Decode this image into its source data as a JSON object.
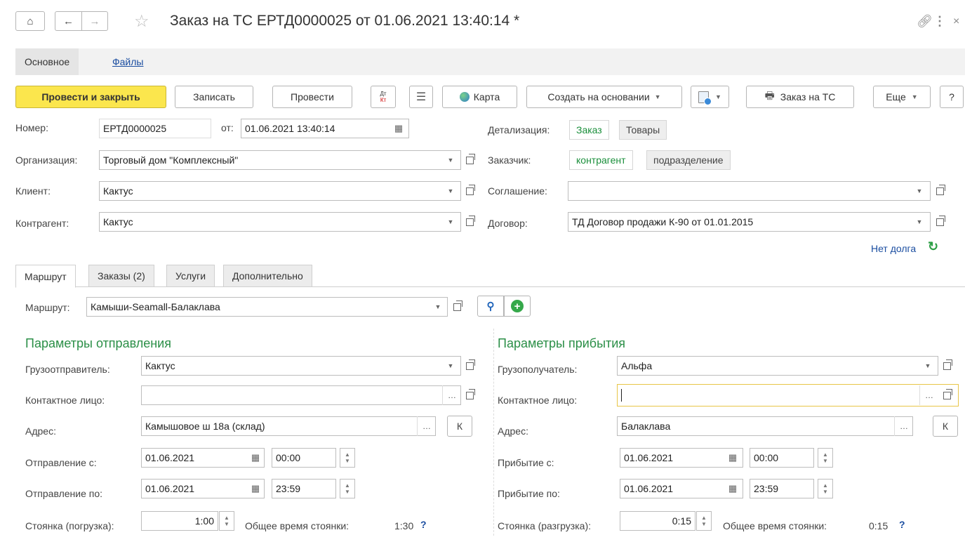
{
  "window": {
    "title": "Заказ на ТС ЕРТД0000025 от 01.06.2021 13:40:14 *"
  },
  "tabs": {
    "main": "Основное",
    "files": "Файлы"
  },
  "toolbar": {
    "post_close": "Провести и закрыть",
    "write": "Записать",
    "post": "Провести",
    "dtkt_top": "Дт",
    "dtkt_bottom": "Кт",
    "map": "Карта",
    "create_based": "Создать на основании",
    "order_ts": "Заказ на ТС",
    "more": "Еще",
    "help": "?"
  },
  "header": {
    "number_label": "Номер:",
    "number_value": "ЕРТД0000025",
    "from_label": "от:",
    "date_value": "01.06.2021 13:40:14",
    "org_label": "Организация:",
    "org_value": "Торговый дом \"Комплексный\"",
    "client_label": "Клиент:",
    "client_value": "Кактус",
    "counterparty_label": "Контрагент:",
    "counterparty_value": "Кактус",
    "detail_label": "Детализация:",
    "detail_options": [
      "Заказ",
      "Товары"
    ],
    "customer_label": "Заказчик:",
    "customer_options": [
      "контрагент",
      "подразделение"
    ],
    "agreement_label": "Соглашение:",
    "agreement_value": "",
    "contract_label": "Договор:",
    "contract_value": "ТД Договор продажи К-90 от 01.01.2015",
    "debt_status": "Нет долга"
  },
  "form_tabs": [
    "Маршрут",
    "Заказы (2)",
    "Услуги",
    "Дополнительно"
  ],
  "route": {
    "label": "Маршрут:",
    "value": "Камыши-Seamall-Балаклава"
  },
  "departure": {
    "title": "Параметры отправления",
    "shipper_label": "Грузоотправитель:",
    "shipper_value": "Кактус",
    "contact_label": "Контактное лицо:",
    "contact_value": "",
    "address_label": "Адрес:",
    "address_value": "Камышовое ш 18а (склад)",
    "k_button": "К",
    "from_label": "Отправление с:",
    "from_date": "01.06.2021",
    "from_time": "00:00",
    "to_label": "Отправление по:",
    "to_date": "01.06.2021",
    "to_time": "23:59",
    "stop_label": "Стоянка (погрузка):",
    "stop_value": "1:00",
    "total_label": "Общее время стоянки:",
    "total_value": "1:30",
    "help": "?"
  },
  "arrival": {
    "title": "Параметры прибытия",
    "consignee_label": "Грузополучатель:",
    "consignee_value": "Альфа",
    "contact_label": "Контактное лицо:",
    "contact_value": "",
    "address_label": "Адрес:",
    "address_value": "Балаклава",
    "k_button": "К",
    "from_label": "Прибытие с:",
    "from_date": "01.06.2021",
    "from_time": "00:00",
    "to_label": "Прибытие по:",
    "to_date": "01.06.2021",
    "to_time": "23:59",
    "stop_label": "Стоянка (разгрузка):",
    "stop_value": "0:15",
    "total_label": "Общее время стоянки:",
    "total_value": "0:15",
    "help": "?"
  }
}
